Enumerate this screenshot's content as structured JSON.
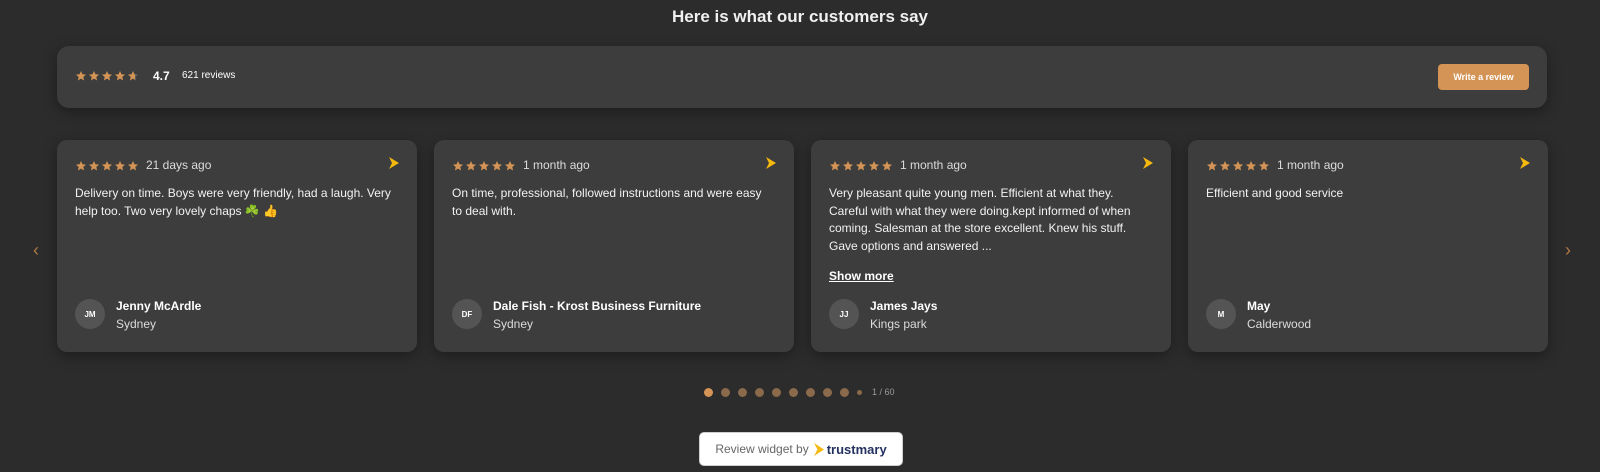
{
  "heading": "Here is what our customers say",
  "summary": {
    "rating": "4.7",
    "rating_value": 4.7,
    "count_text": "621 reviews",
    "write_button": "Write a review"
  },
  "colors": {
    "star": "#d39455",
    "accent": "#d39455",
    "card_bg": "#3d3d3d",
    "page_bg": "#2c2c2c"
  },
  "nav": {
    "prev_icon": "chevron-left-icon",
    "next_icon": "chevron-right-icon"
  },
  "reviews": [
    {
      "stars": 5,
      "date": "21 days ago",
      "text": "Delivery on time. Boys were very friendly, had a laugh. Very help too. Two very lovely chaps ☘️ 👍",
      "show_more": "",
      "initials": "JM",
      "name": "Jenny McArdle",
      "location": "Sydney"
    },
    {
      "stars": 5,
      "date": "1 month ago",
      "text": "On time, professional, followed instructions and were easy to deal with.",
      "show_more": "",
      "initials": "DF",
      "name": "Dale Fish - Krost Business Furniture",
      "location": "Sydney"
    },
    {
      "stars": 5,
      "date": "1 month ago",
      "text": "Very pleasant quite young men. Efficient at what they. Careful with what they were doing.kept informed of when coming. Salesman at the store excellent. Knew his stuff. Gave options and answered ...",
      "show_more": "Show more",
      "initials": "JJ",
      "name": "James Jays",
      "location": "Kings park"
    },
    {
      "stars": 5,
      "date": "1 month ago",
      "text": "Efficient and good service",
      "show_more": "",
      "initials": "M",
      "name": "May",
      "location": "Calderwood"
    }
  ],
  "pagination": {
    "page_text": "1 / 60",
    "current": 1,
    "visible_dots": 10
  },
  "footer": {
    "prefix": "Review widget by",
    "brand": "trustmary"
  }
}
